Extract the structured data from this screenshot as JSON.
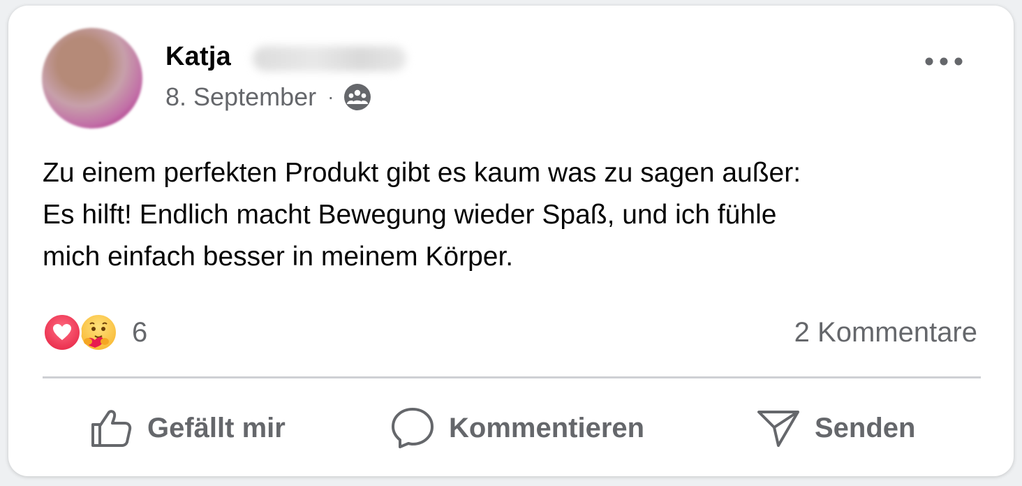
{
  "post": {
    "author_first_name": "Katja",
    "date": "8. September",
    "meta_separator": "·",
    "audience_icon": "group-icon",
    "more_icon": "more-horizontal-icon",
    "text": "Zu einem perfekten Produkt gibt es kaum was zu sagen außer:\nEs hilft! Endlich macht Bewegung wieder Spaß, und ich fühle\nmich einfach besser in meinem Körper.",
    "reactions": {
      "types": [
        "love",
        "care"
      ],
      "count": "6"
    },
    "comments_label": "2 Kommentare"
  },
  "actions": {
    "like_label": "Gefällt mir",
    "comment_label": "Kommentieren",
    "share_label": "Senden"
  },
  "colors": {
    "text_primary": "#050505",
    "text_secondary": "#65676b",
    "divider": "#ced0d4",
    "love": "#e41e3f",
    "care": "#f7b125"
  }
}
